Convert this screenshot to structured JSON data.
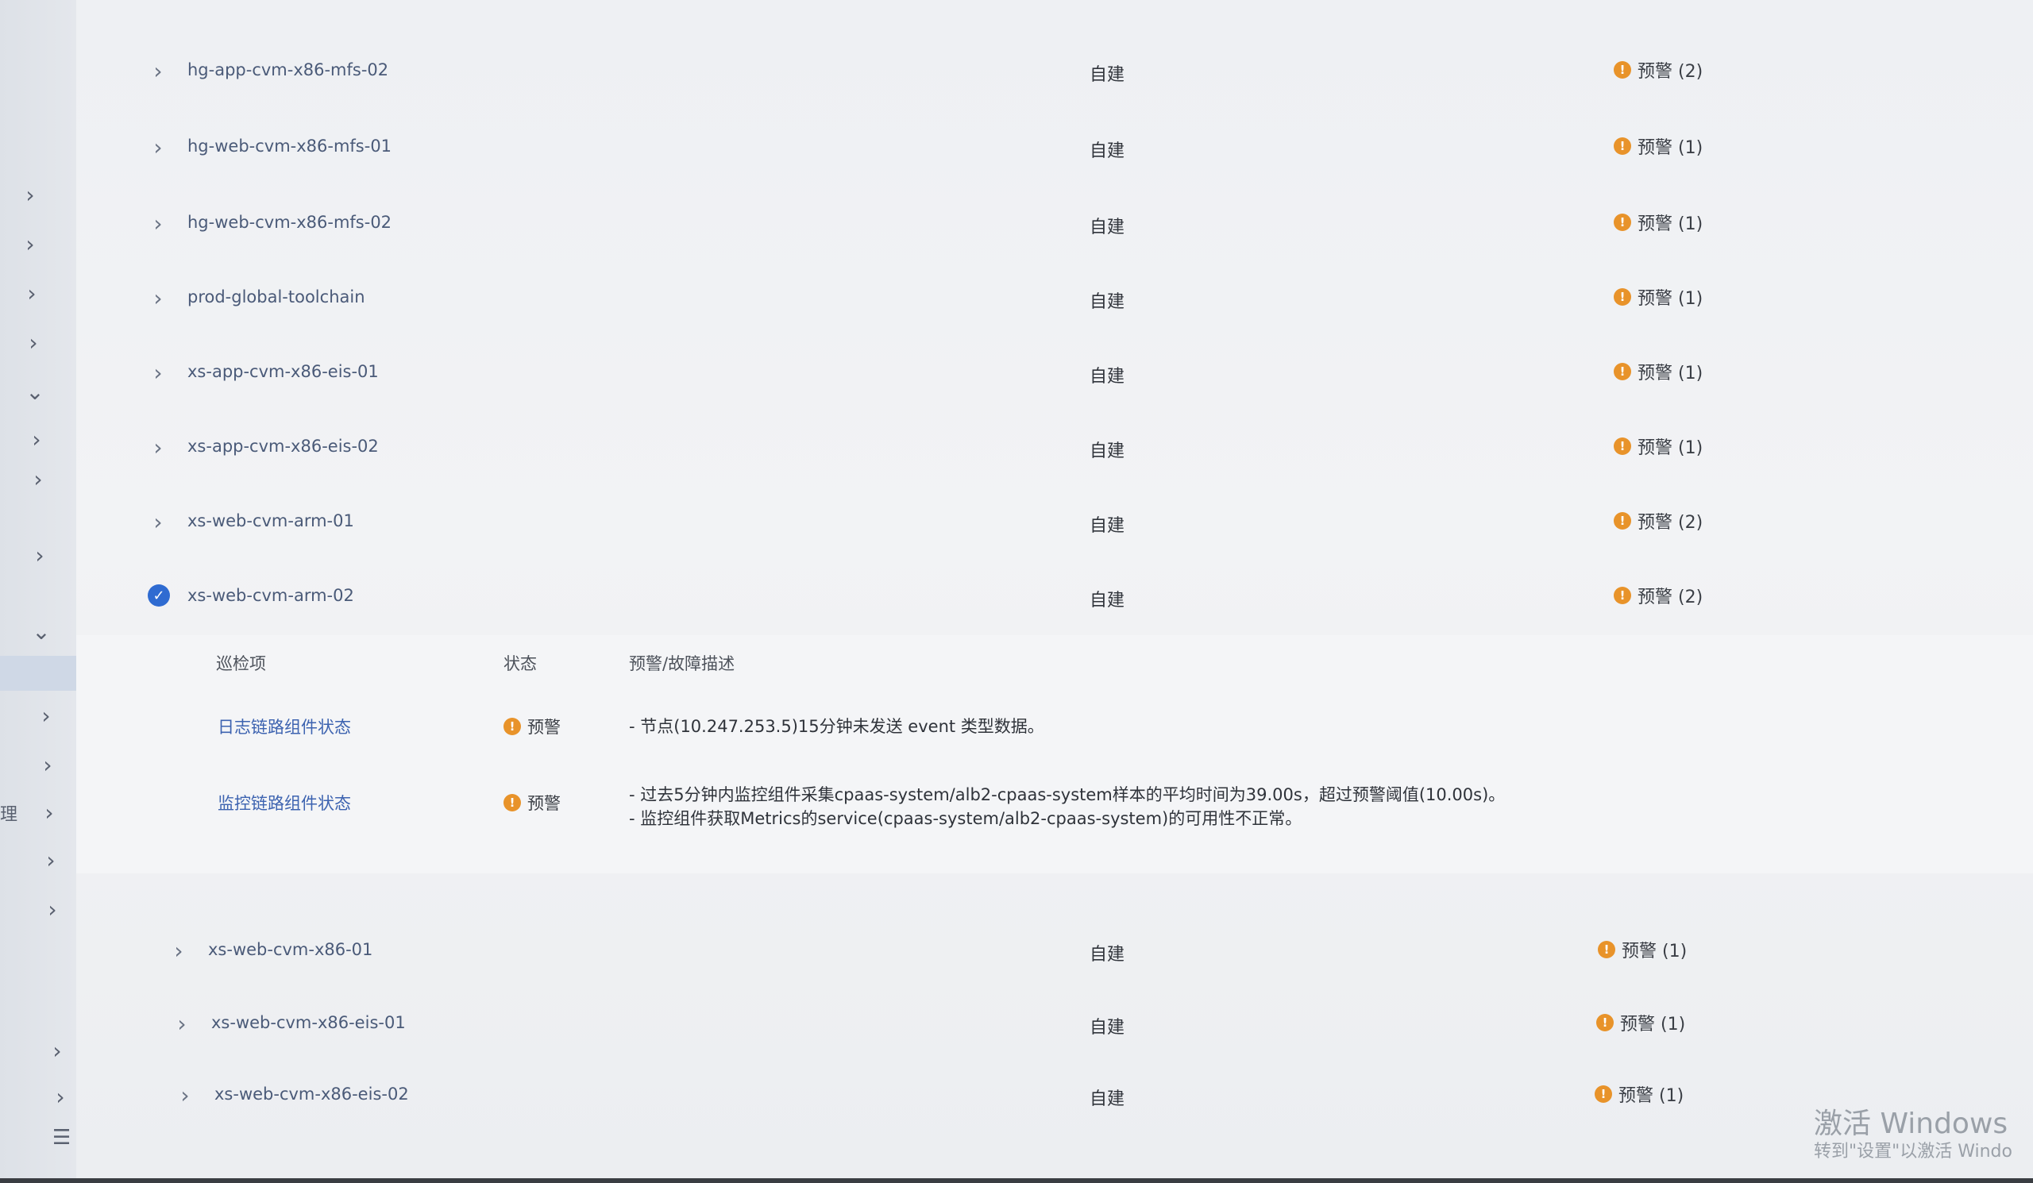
{
  "source_label": "自建",
  "rows_top": [
    {
      "name": "hg-app-cvm-x86-mfs-02",
      "status": "预警 (2)"
    },
    {
      "name": "hg-web-cvm-x86-mfs-01",
      "status": "预警 (1)"
    },
    {
      "name": "hg-web-cvm-x86-mfs-02",
      "status": "预警 (1)"
    },
    {
      "name": "prod-global-toolchain",
      "status": "预警 (1)"
    },
    {
      "name": "xs-app-cvm-x86-eis-01",
      "status": "预警 (1)"
    },
    {
      "name": "xs-app-cvm-x86-eis-02",
      "status": "预警 (1)"
    },
    {
      "name": "xs-web-cvm-arm-01",
      "status": "预警 (2)"
    }
  ],
  "expanded_row": {
    "name": "xs-web-cvm-arm-02",
    "status": "预警 (2)"
  },
  "detail": {
    "headers": {
      "item": "巡检项",
      "state": "状态",
      "desc": "预警/故障描述"
    },
    "items": [
      {
        "name": "日志链路组件状态",
        "state": "预警",
        "desc": [
          "- 节点(10.247.253.5)15分钟未发送 event 类型数据。"
        ]
      },
      {
        "name": "监控链路组件状态",
        "state": "预警",
        "desc": [
          "- 过去5分钟内监控组件采集cpaas-system/alb2-cpaas-system样本的平均时间为39.00s，超过预警阈值(10.00s)。",
          "- 监控组件获取Metrics的service(cpaas-system/alb2-cpaas-system)的可用性不正常。"
        ]
      }
    ]
  },
  "rows_bottom": [
    {
      "name": "xs-web-cvm-x86-01",
      "status": "预警 (1)"
    },
    {
      "name": "xs-web-cvm-x86-eis-01",
      "status": "预警 (1)"
    },
    {
      "name": "xs-web-cvm-x86-eis-02",
      "status": "预警 (1)"
    }
  ],
  "sidebar": {
    "cutoff_text": "理"
  },
  "watermark": {
    "title": "激活 Windows",
    "subtitle": "转到\"设置\"以激活 Windo"
  },
  "colors": {
    "warning": "#e8932a",
    "selected": "#2f6bd1",
    "link": "#3d63b0"
  },
  "icons": {
    "expand": "chevron-right-icon",
    "collapse": "chevron-down-icon",
    "warning": "warning-icon",
    "selected": "check-circle-icon",
    "menu": "menu-icon"
  }
}
